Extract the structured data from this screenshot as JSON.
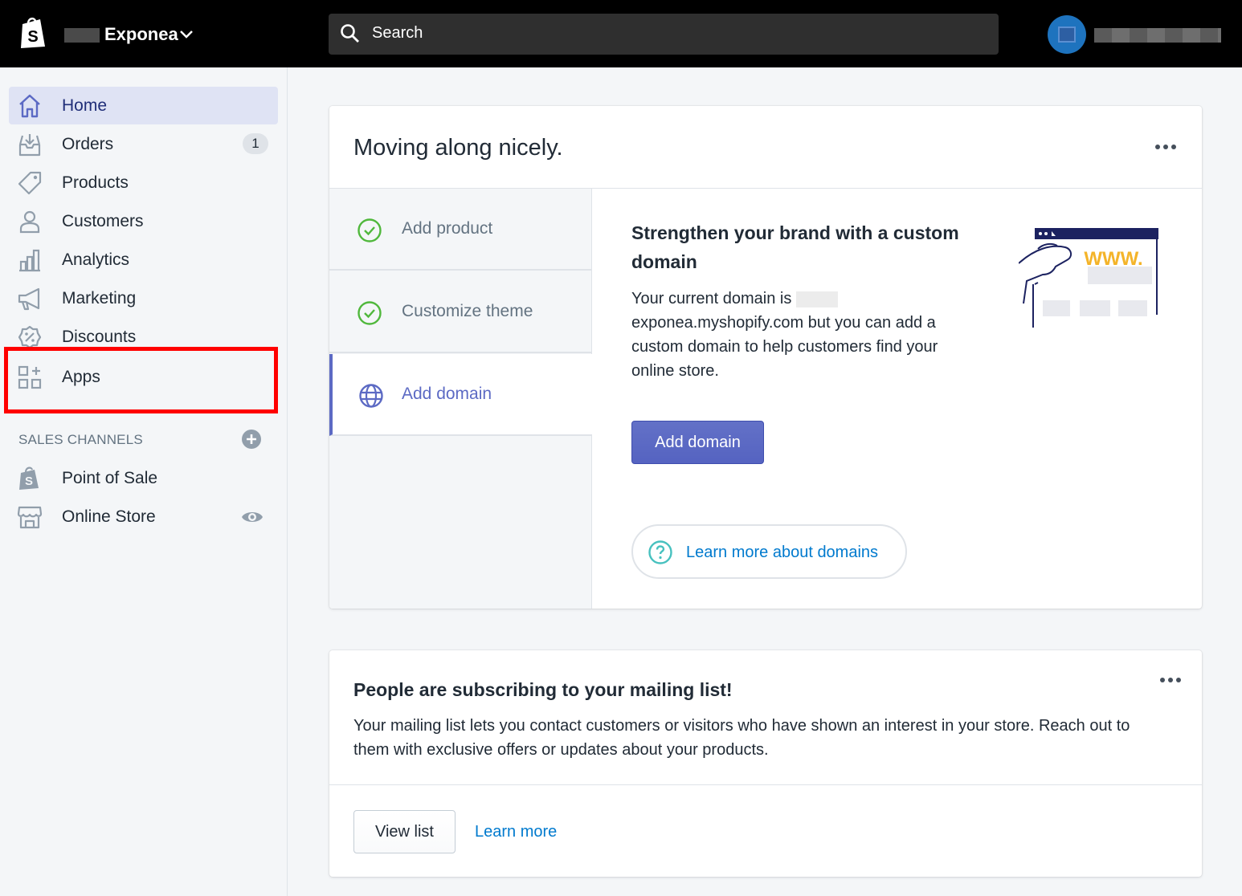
{
  "topbar": {
    "store_name": "Exponea",
    "search_placeholder": "Search"
  },
  "sidebar": {
    "items": [
      {
        "label": "Home",
        "icon": "home-icon"
      },
      {
        "label": "Orders",
        "icon": "orders-icon",
        "badge": "1"
      },
      {
        "label": "Products",
        "icon": "tag-icon"
      },
      {
        "label": "Customers",
        "icon": "person-icon"
      },
      {
        "label": "Analytics",
        "icon": "bar-chart-icon"
      },
      {
        "label": "Marketing",
        "icon": "megaphone-icon"
      },
      {
        "label": "Discounts",
        "icon": "discount-icon"
      },
      {
        "label": "Apps",
        "icon": "apps-icon"
      }
    ],
    "sales_channels_label": "SALES CHANNELS",
    "channels": [
      {
        "label": "Point of Sale",
        "icon": "pos-bag-icon"
      },
      {
        "label": "Online Store",
        "icon": "storefront-icon"
      }
    ]
  },
  "setup_card": {
    "title": "Moving along nicely.",
    "steps": [
      {
        "label": "Add product",
        "status": "complete"
      },
      {
        "label": "Customize theme",
        "status": "complete"
      },
      {
        "label": "Add domain",
        "status": "active"
      }
    ],
    "detail_title": "Strengthen your brand with a custom domain",
    "detail_text_prefix": "Your current domain is",
    "detail_text_suffix": "exponea.myshopify.com but you can add a custom domain to help customers find your online store.",
    "primary_button": "Add domain",
    "learn_more": "Learn more about domains",
    "illustration_text": "WWW."
  },
  "mailing_card": {
    "title": "People are subscribing to your mailing list!",
    "text": "Your mailing list lets you contact customers or visitors who have shown an interest in your store. Reach out to them with exclusive offers or updates about your products.",
    "view_button": "View list",
    "learn_link": "Learn more"
  },
  "colors": {
    "topbar": "#000000",
    "accent": "#5c6ac4",
    "link": "#007ace",
    "success": "#50b83c",
    "highlight_box": "#ff0000"
  }
}
